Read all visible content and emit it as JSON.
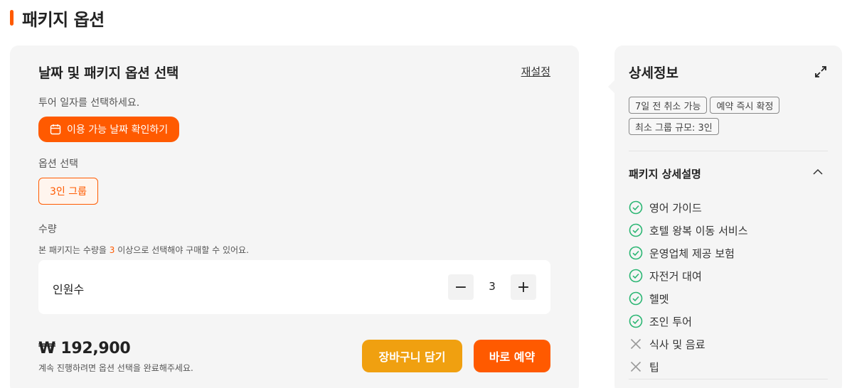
{
  "section": {
    "title": "패키지 옵션"
  },
  "options_panel": {
    "title": "날짜 및 패키지 옵션 선택",
    "reset_label": "재설정",
    "date_prompt": "투어 일자를 선택하세요.",
    "date_button_label": "이용 가능 날짜 확인하기",
    "option_label": "옵션 선택",
    "option_selected": "3인 그룹",
    "quantity_label": "수량",
    "quantity_note_before": "본 패키지는 수량을 ",
    "quantity_note_min": "3",
    "quantity_note_after": " 이상으로 선택해야 구매할 수 있어요.",
    "quantity_row_label": "인원수",
    "quantity_value": "3",
    "minus_symbol": "−",
    "plus_symbol": "+",
    "price": "₩ 192,900",
    "price_note": "계속 진행하려면 옵션 선택을 완료해주세요.",
    "cart_button": "장바구니 담기",
    "book_button": "바로 예약"
  },
  "details_panel": {
    "title": "상세정보",
    "tags": [
      "7일 전 취소 가능",
      "예약 즉시 확정",
      "최소 그룹 규모: 3인"
    ],
    "package_title": "패키지 상세설명",
    "features": [
      {
        "label": "영어 가이드",
        "included": true,
        "icon": "check-circle-icon"
      },
      {
        "label": "호텔 왕복 이동 서비스",
        "included": true,
        "icon": "check-circle-icon"
      },
      {
        "label": "운영업체 제공 보험",
        "included": true,
        "icon": "check-circle-icon"
      },
      {
        "label": "자전거 대여",
        "included": true,
        "icon": "check-circle-icon"
      },
      {
        "label": "헬멧",
        "included": true,
        "icon": "check-circle-icon"
      },
      {
        "label": "조인 투어",
        "included": true,
        "icon": "check-circle-icon"
      },
      {
        "label": "식사 및 음료",
        "included": false,
        "icon": "x-icon"
      },
      {
        "label": "팁",
        "included": false,
        "icon": "x-icon"
      }
    ]
  },
  "colors": {
    "accent": "#ff5a00",
    "cart": "#f0a010",
    "included": "#2bb673",
    "excluded": "#999999",
    "panel_bg": "#f5f5f5"
  }
}
